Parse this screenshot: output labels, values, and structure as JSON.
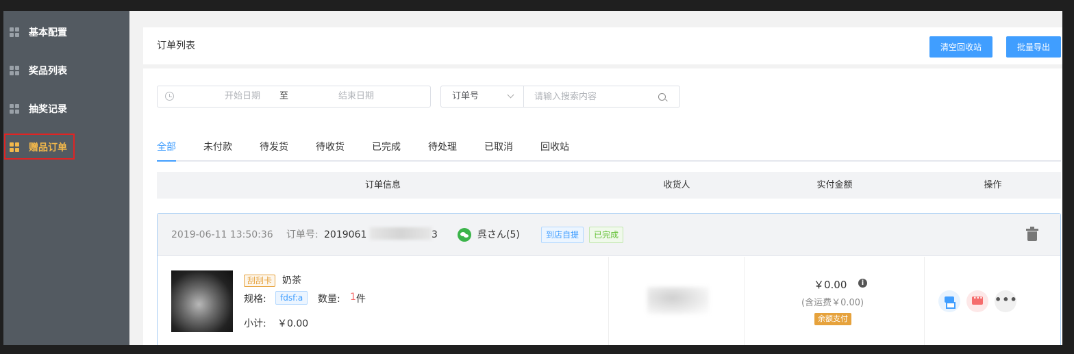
{
  "sidebar": {
    "items": [
      {
        "label": "基本配置"
      },
      {
        "label": "奖品列表"
      },
      {
        "label": "抽奖记录"
      },
      {
        "label": "赠品订单"
      }
    ]
  },
  "header": {
    "title": "订单列表",
    "clear_label": "清空回收站",
    "export_label": "批量导出"
  },
  "filters": {
    "date_start_placeholder": "开始日期",
    "date_sep": "至",
    "date_end_placeholder": "结束日期",
    "search_type": "订单号",
    "search_placeholder": "请输入搜索内容"
  },
  "tabs": [
    "全部",
    "未付款",
    "待发货",
    "待收货",
    "已完成",
    "待处理",
    "已取消",
    "回收站"
  ],
  "table": {
    "columns": [
      "订单信息",
      "收货人",
      "实付金额",
      "操作"
    ]
  },
  "order": {
    "time": "2019-06-11 13:50:36",
    "order_no_label": "订单号:",
    "order_no_prefix": "2019061",
    "order_no_suffix": "3",
    "buyer": "呉さん(5)",
    "badge_pickup": "到店自提",
    "badge_done": "已完成",
    "product_tag": "刮刮卡",
    "product_name": "奶茶",
    "spec_label": "规格:",
    "spec_value": "fdsf:a",
    "qty_label": "数量:",
    "qty_num": "1",
    "qty_unit": "件",
    "subtotal_label": "小计:",
    "subtotal_value": "￥0.00",
    "amount": "￥0.00",
    "shipping": "(含运费￥0.00)",
    "pay_method": "余额支付",
    "more_label": "•••"
  },
  "colors": {
    "accent": "#409eff",
    "sidebar_bg": "#535a61",
    "active_menu": "#f2b84b",
    "highlight_border": "#e02424"
  }
}
